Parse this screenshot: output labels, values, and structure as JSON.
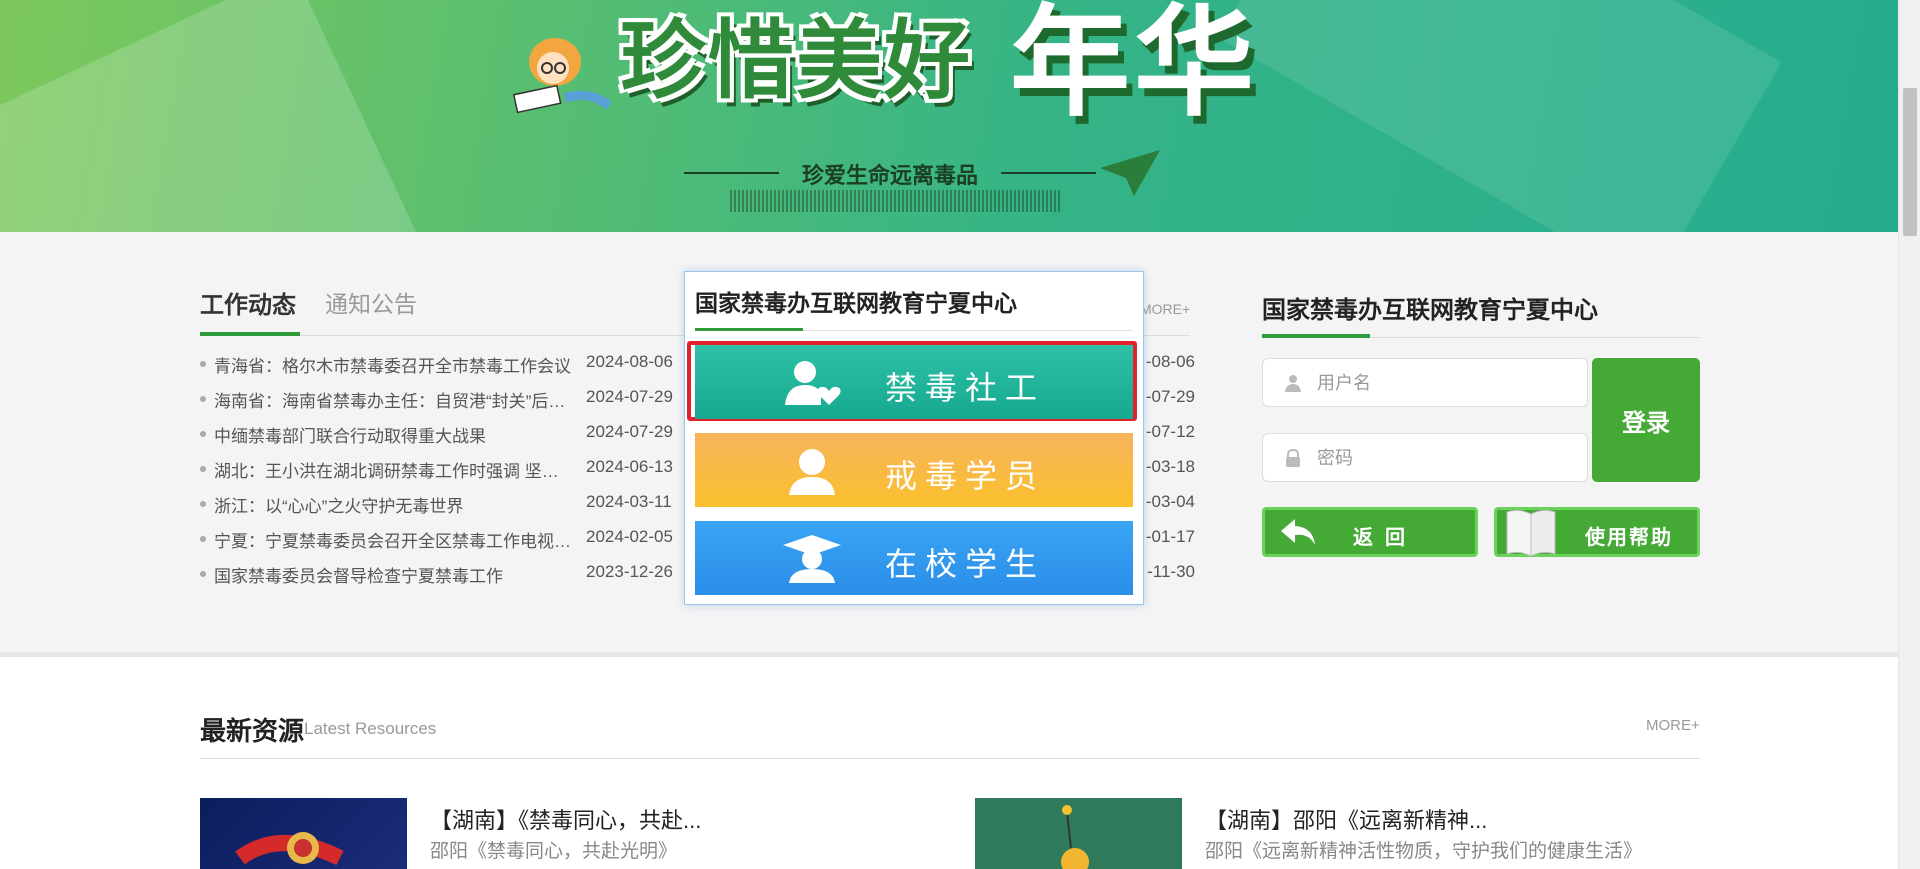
{
  "banner": {
    "title_line": "珍惜美好",
    "title_big": "年华",
    "slogan": "珍爱生命远离毒品"
  },
  "news": {
    "tabs": [
      {
        "label": "工作动态"
      },
      {
        "label": "通知公告"
      }
    ],
    "more": "MORE+",
    "items": [
      {
        "title": "青海省：格尔木市禁毒委召开全市禁毒工作会议",
        "date": "2024-08-06"
      },
      {
        "title": "海南省：海南省禁毒办主任：自贸港“封关”后禁毒工作",
        "date": "2024-07-29"
      },
      {
        "title": "中缅禁毒部门联合行动取得重大战果",
        "date": "2024-07-29"
      },
      {
        "title": "湖北：王小洪在湖北调研禁毒工作时强调 坚决打赢",
        "date": "2024-06-13"
      },
      {
        "title": "浙江：以“心心”之火守护无毒世界",
        "date": "2024-03-11"
      },
      {
        "title": "宁夏：宁夏禁毒委员会召开全区禁毒工作电视电话会议",
        "date": "2024-02-05"
      },
      {
        "title": "国家禁毒委员会督导检查宁夏禁毒工作",
        "date": "2023-12-26"
      }
    ],
    "hidden_dates": [
      "-08-06",
      "-07-29",
      "-07-12",
      "-03-18",
      "-03-04",
      "-01-17",
      "-11-30"
    ]
  },
  "popup": {
    "title": "国家禁毒办互联网教育宁夏中心",
    "roles": [
      {
        "label": "禁毒社工",
        "icon": "social-worker-icon",
        "color": "#20b59b"
      },
      {
        "label": "戒毒学员",
        "icon": "trainee-icon",
        "color": "#f9b842"
      },
      {
        "label": "在校学生",
        "icon": "graduate-icon",
        "color": "#339af0"
      }
    ]
  },
  "login": {
    "title": "国家禁毒办互联网教育宁夏中心",
    "username_placeholder": "用户名",
    "password_placeholder": "密码",
    "login_label": "登录",
    "back_label": "返回",
    "help_label": "使用帮助"
  },
  "resources": {
    "title": "最新资源",
    "subtitle": "Latest Resources",
    "more": "MORE+",
    "items": [
      {
        "headline": "【湖南】《禁毒同心，共赴...",
        "desc": "邵阳《禁毒同心，共赴光明》"
      },
      {
        "headline": "【湖南】邵阳《远离新精神...",
        "desc": "邵阳《远离新精神活性物质，守护我们的健康生活》"
      }
    ]
  },
  "colors": {
    "brand_green": "#45a935",
    "accent_line": "#2e9b3a",
    "highlight_red": "#e0232a"
  }
}
